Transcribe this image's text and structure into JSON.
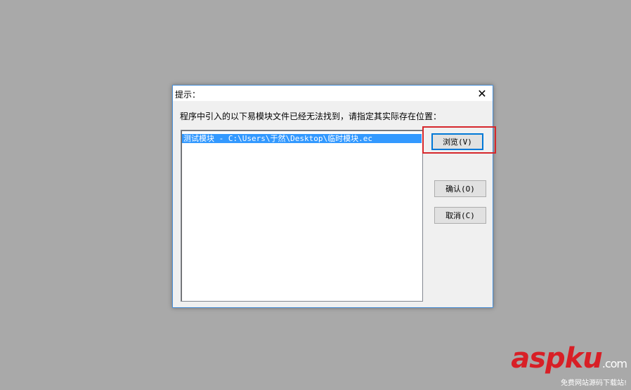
{
  "dialog": {
    "title": "提示：",
    "close_glyph": "✕",
    "prompt": "程序中引入的以下易模块文件已经无法找到，请指定其实际存在位置：",
    "list_items": [
      "测试模块 - C:\\Users\\于然\\Desktop\\临时模块.ec"
    ],
    "buttons": {
      "browse": "浏览(V)",
      "confirm": "确认(O)",
      "cancel": "取消(C)"
    }
  },
  "colors": {
    "background": "#a9a9a9",
    "selection": "#3399ff",
    "highlight_box": "#d6262b"
  },
  "watermark": {
    "brand": "aspku",
    "tld": ".com",
    "tagline": "免费网站源码下载站!"
  }
}
